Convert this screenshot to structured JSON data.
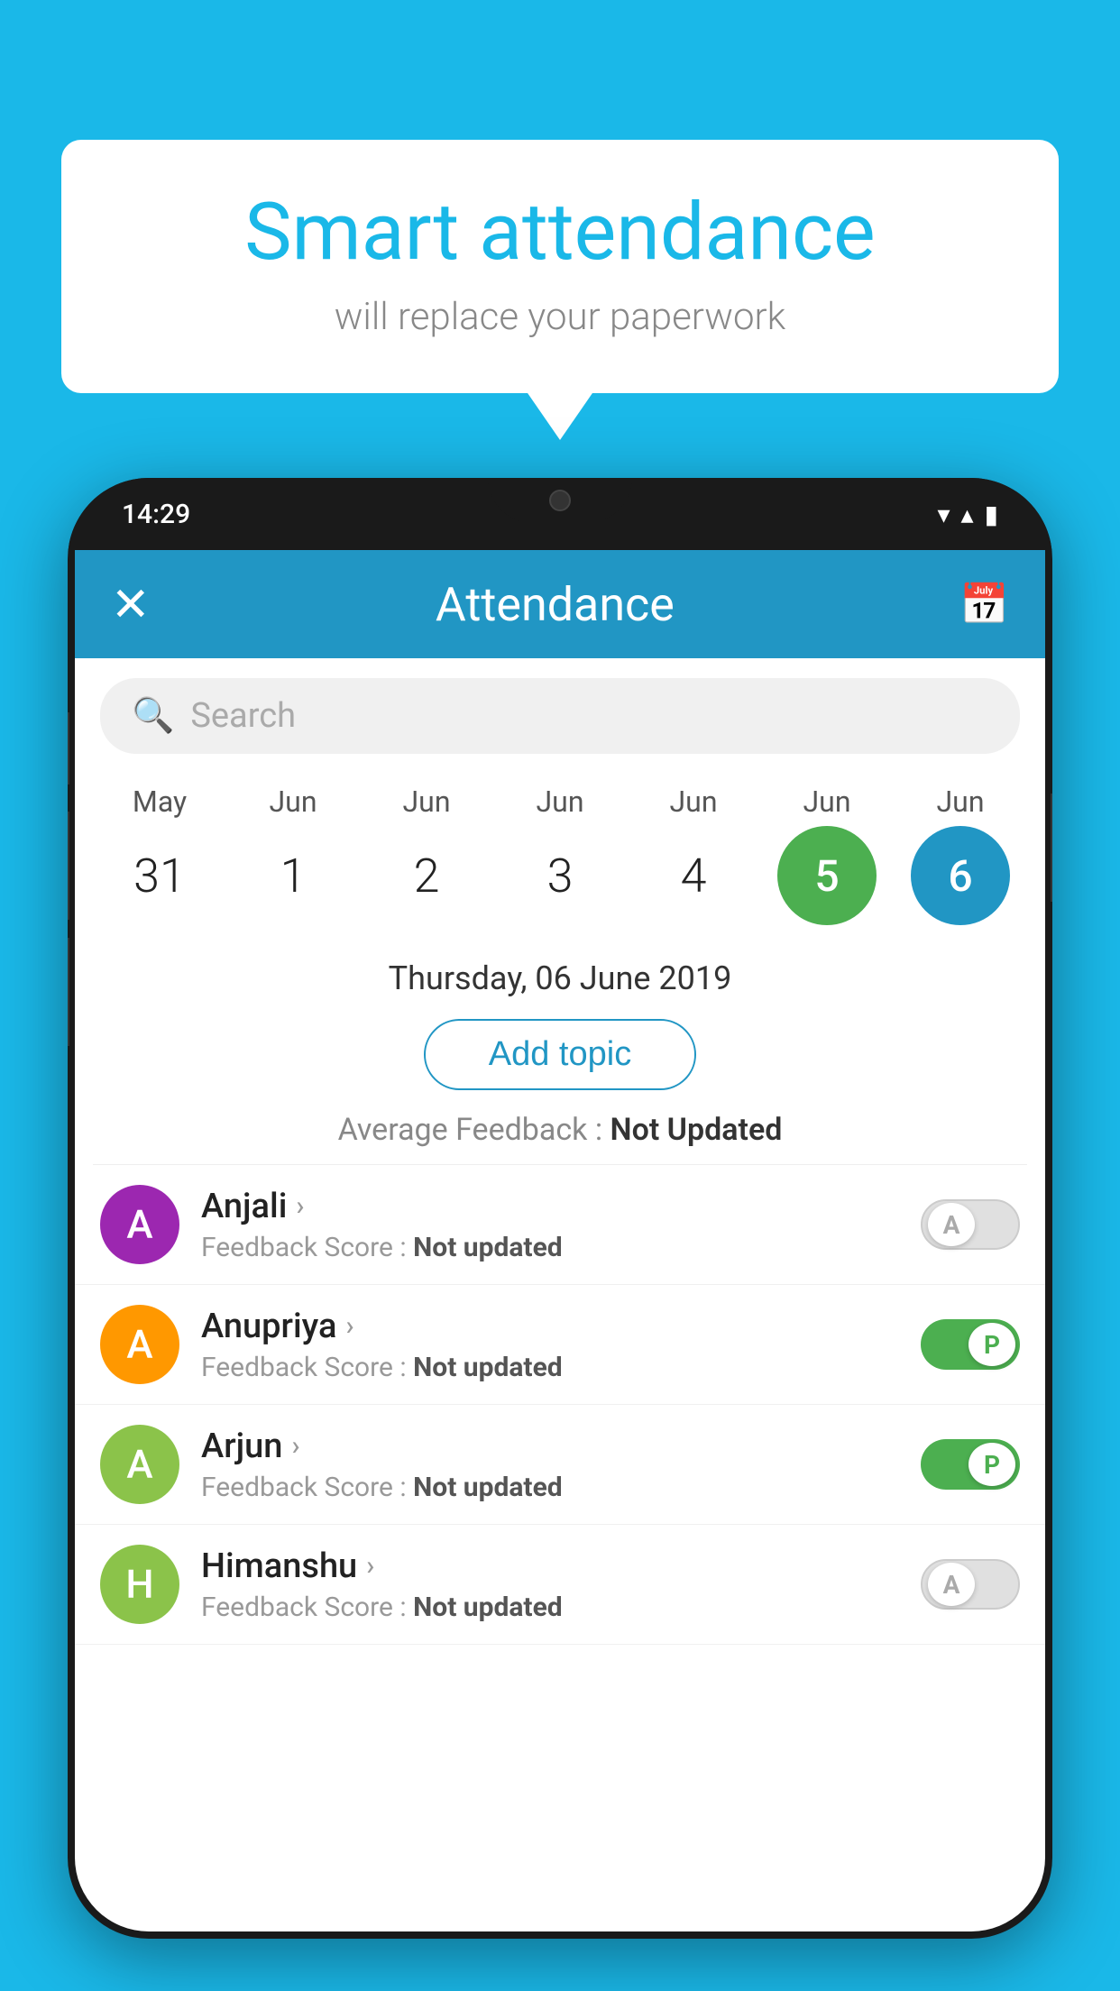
{
  "background_color": "#1ab8e8",
  "bubble": {
    "title": "Smart attendance",
    "subtitle": "will replace your paperwork"
  },
  "phone": {
    "status_bar": {
      "time": "14:29",
      "icons": "▾ ▴ ▮"
    },
    "header": {
      "close_label": "✕",
      "title": "Attendance",
      "calendar_icon": "📅"
    },
    "search": {
      "placeholder": "Search"
    },
    "calendar": {
      "months": [
        "May",
        "Jun",
        "Jun",
        "Jun",
        "Jun",
        "Jun",
        "Jun"
      ],
      "dates": [
        "31",
        "1",
        "2",
        "3",
        "4",
        "5",
        "6"
      ],
      "today_index_green": 5,
      "today_index_blue": 6
    },
    "selected_date": "Thursday, 06 June 2019",
    "add_topic_label": "Add topic",
    "feedback_summary": {
      "label": "Average Feedback :",
      "value": "Not Updated"
    },
    "students": [
      {
        "name": "Anjali",
        "avatar_letter": "A",
        "avatar_color": "#9c27b0",
        "feedback": "Not updated",
        "toggle": "off",
        "toggle_label": "A"
      },
      {
        "name": "Anupriya",
        "avatar_letter": "A",
        "avatar_color": "#ff9800",
        "feedback": "Not updated",
        "toggle": "on",
        "toggle_label": "P"
      },
      {
        "name": "Arjun",
        "avatar_letter": "A",
        "avatar_color": "#8bc34a",
        "feedback": "Not updated",
        "toggle": "on",
        "toggle_label": "P"
      },
      {
        "name": "Himanshu",
        "avatar_letter": "H",
        "avatar_color": "#8bc34a",
        "feedback": "Not updated",
        "toggle": "off",
        "toggle_label": "A"
      }
    ]
  }
}
